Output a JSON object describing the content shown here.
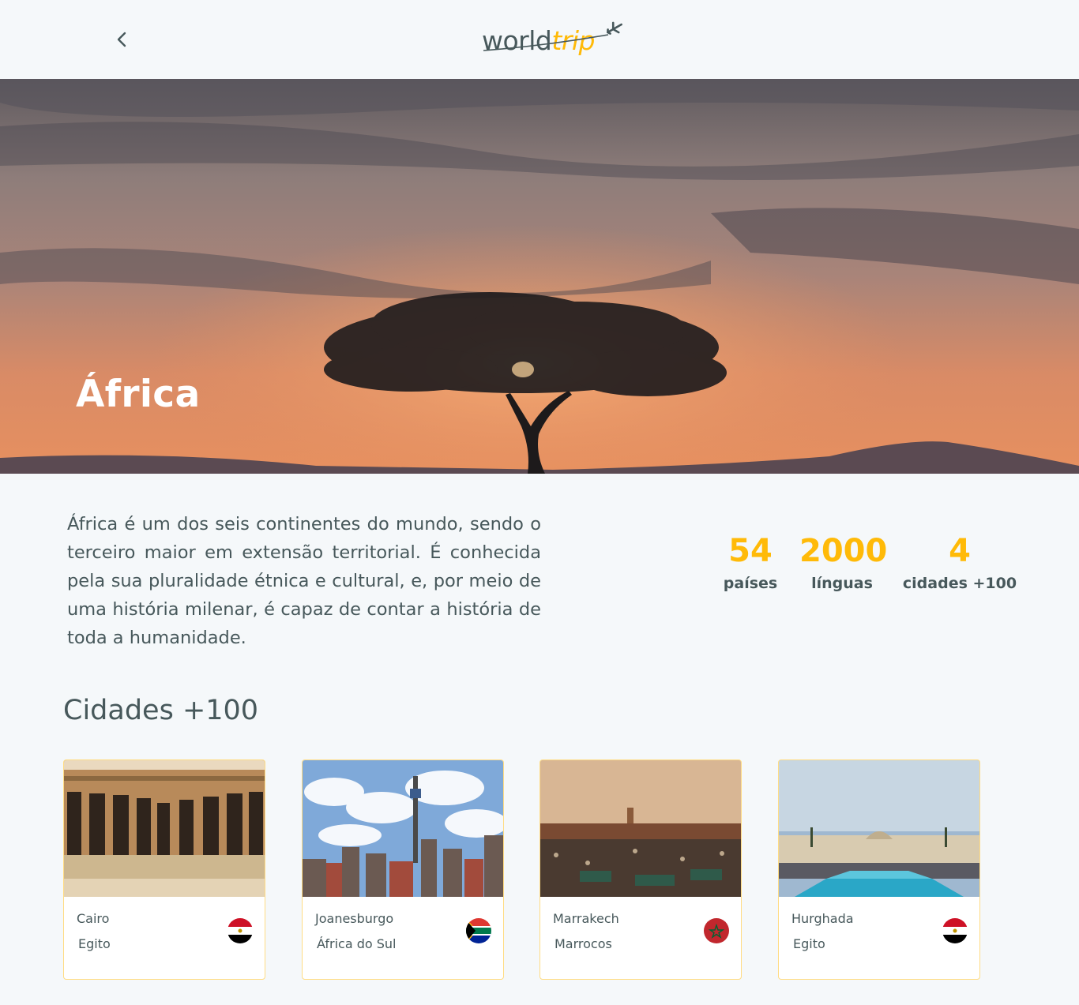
{
  "header": {
    "back_icon": "chevron-left-icon",
    "logo": {
      "part1": "world",
      "part2": "trip",
      "icon": "airplane-icon"
    }
  },
  "hero": {
    "title": "África"
  },
  "intro": {
    "text": "África é um dos seis continentes do mundo, sendo o terceiro maior em extensão territorial. É conhecida pela sua pluralidade étnica e cultural, e, por meio de uma história milenar, é capaz de contar a história de toda a humanidade."
  },
  "stats": [
    {
      "value": "54",
      "label": "países"
    },
    {
      "value": "2000",
      "label": "línguas"
    },
    {
      "value": "4",
      "label": "cidades +100"
    }
  ],
  "cities_section": {
    "title": "Cidades +100"
  },
  "cities": [
    {
      "city": "Cairo",
      "country": "Egito",
      "flag": "egypt-flag-icon"
    },
    {
      "city": "Joanesburgo",
      "country": "África do Sul",
      "flag": "south-africa-flag-icon"
    },
    {
      "city": "Marrakech",
      "country": "Marrocos",
      "flag": "morocco-flag-icon"
    },
    {
      "city": "Hurghada",
      "country": "Egito",
      "flag": "egypt-flag-icon"
    }
  ],
  "colors": {
    "highlight": "#ffba08",
    "text": "#47585b",
    "background": "#f5f8fa"
  }
}
